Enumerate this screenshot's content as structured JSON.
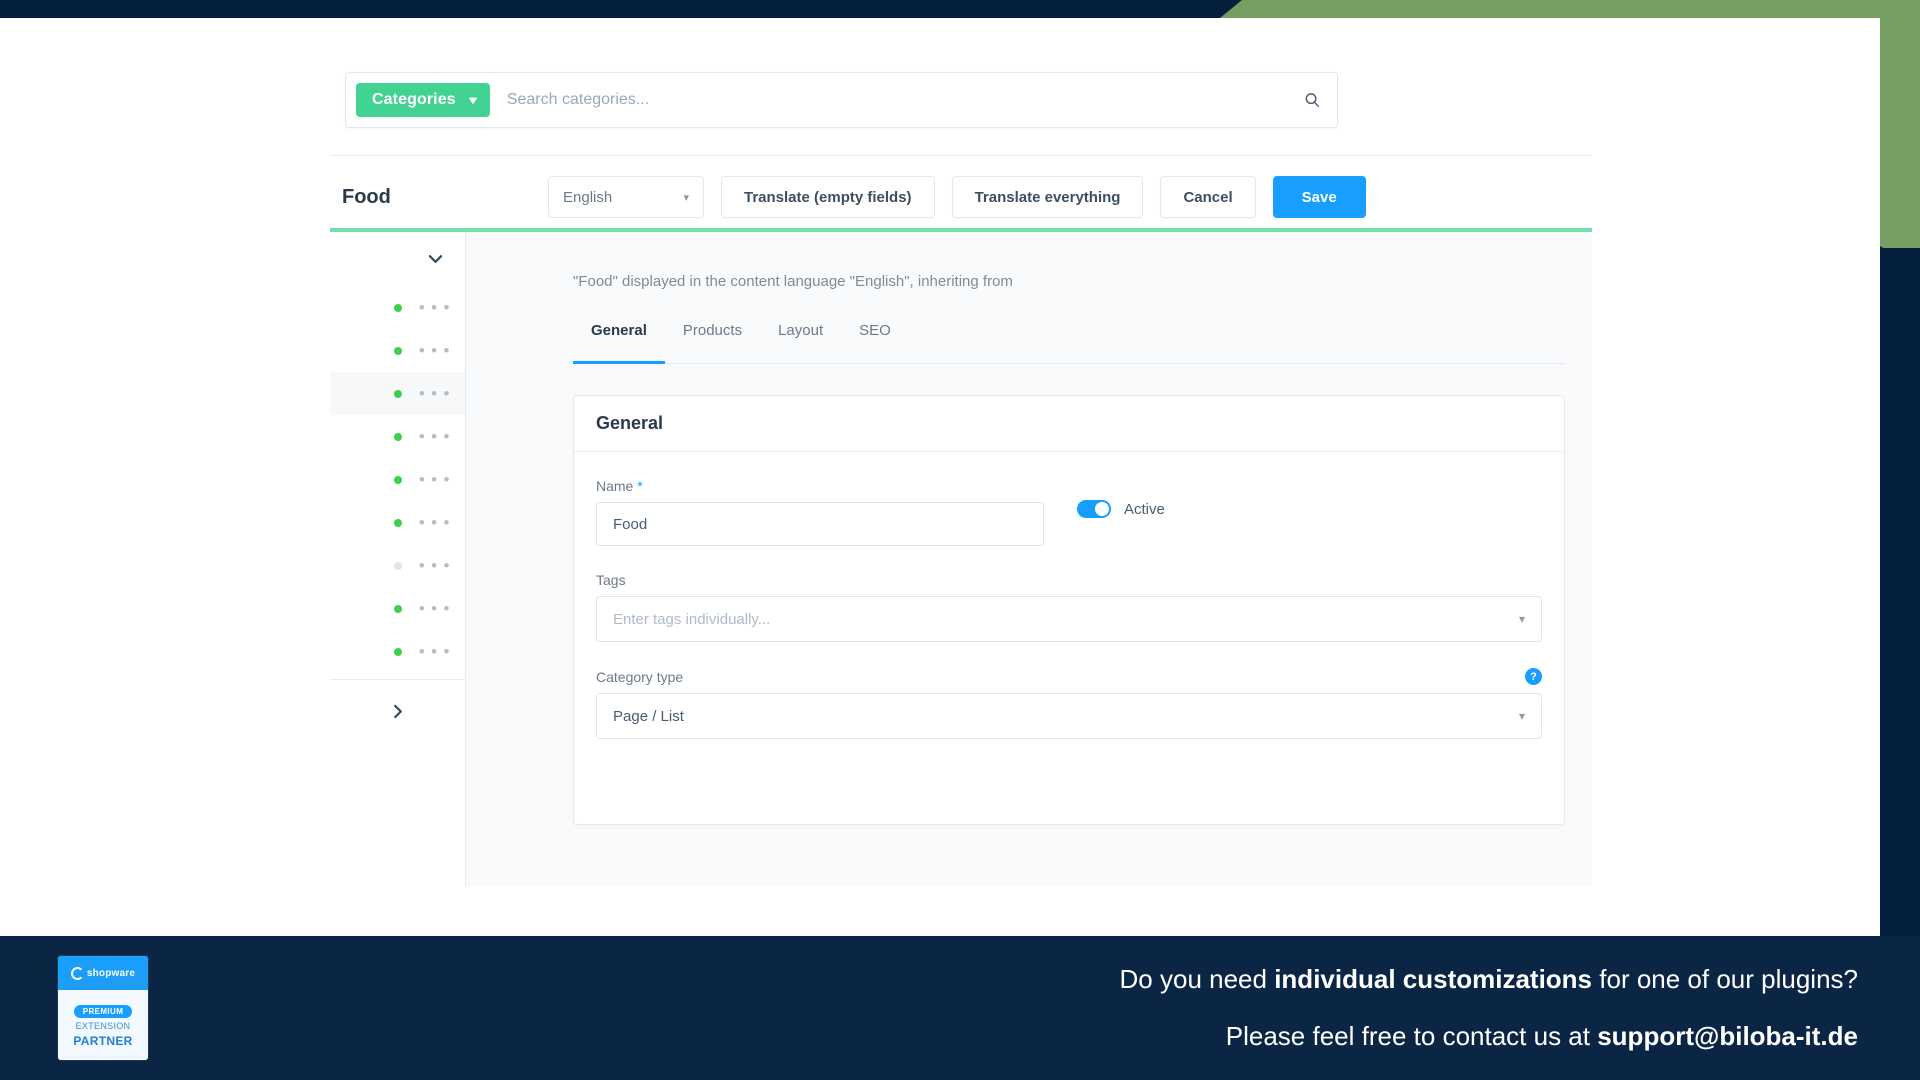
{
  "colors": {
    "accent_green": "#42d392",
    "accent_blue": "#189eff",
    "navy": "#0b2545",
    "olive": "#769e63",
    "status_active": "#3ecf4c",
    "status_inactive": "#dfe4e9"
  },
  "search": {
    "scope_button_label": "Categories",
    "scope_chevron_icon": "chevron-down-icon",
    "placeholder": "Search categories...",
    "value": "",
    "search_icon": "search-icon"
  },
  "header": {
    "title": "Food",
    "language": {
      "value": "English",
      "chevron_icon": "chevron-down-icon"
    },
    "buttons": [
      {
        "label": "Translate (empty fields)",
        "style": "secondary"
      },
      {
        "label": "Translate everything",
        "style": "secondary"
      },
      {
        "label": "Cancel",
        "style": "secondary"
      },
      {
        "label": "Save",
        "style": "primary"
      }
    ]
  },
  "sidebar": {
    "collapse_icon": "chevron-down-icon",
    "more_icon": "chevron-right-icon",
    "rows": [
      {
        "status": "active",
        "menu_icon": "ellipsis-icon",
        "selected": false
      },
      {
        "status": "active",
        "menu_icon": "ellipsis-icon",
        "selected": false
      },
      {
        "status": "active",
        "menu_icon": "ellipsis-icon",
        "selected": true
      },
      {
        "status": "active",
        "menu_icon": "ellipsis-icon",
        "selected": false
      },
      {
        "status": "active",
        "menu_icon": "ellipsis-icon",
        "selected": false
      },
      {
        "status": "active",
        "menu_icon": "ellipsis-icon",
        "selected": false
      },
      {
        "status": "inactive",
        "menu_icon": "ellipsis-icon",
        "selected": false
      },
      {
        "status": "active",
        "menu_icon": "ellipsis-icon",
        "selected": false
      },
      {
        "status": "active",
        "menu_icon": "ellipsis-icon",
        "selected": false
      }
    ]
  },
  "content": {
    "inherit_note": "\"Food\" displayed in the content language \"English\", inheriting from",
    "tabs": [
      {
        "label": "General",
        "active": true
      },
      {
        "label": "Products",
        "active": false
      },
      {
        "label": "Layout",
        "active": false
      },
      {
        "label": "SEO",
        "active": false
      }
    ],
    "card": {
      "title": "General",
      "name": {
        "label": "Name",
        "required_marker": "*",
        "value": "Food"
      },
      "active_toggle": {
        "label": "Active",
        "state": "on"
      },
      "tags": {
        "label": "Tags",
        "placeholder": "Enter tags individually...",
        "value": "",
        "chevron_icon": "chevron-down-icon"
      },
      "category_type": {
        "label": "Category type",
        "value": "Page / List",
        "chevron_icon": "chevron-down-icon",
        "help_icon": "help-circle-icon",
        "help_glyph": "?"
      }
    }
  },
  "footer": {
    "badge": {
      "brand": "shopware",
      "brand_icon": "shopware-logo-icon",
      "premium": "PREMIUM",
      "extension": "EXTENSION",
      "partner": "PARTNER"
    },
    "promo_line1_prefix": "Do you need ",
    "promo_line1_bold": "individual customizations",
    "promo_line1_suffix": " for one of our plugins?",
    "promo_line2_prefix": "Please feel free to contact us at ",
    "promo_line2_bold": "support@biloba-it.de"
  }
}
